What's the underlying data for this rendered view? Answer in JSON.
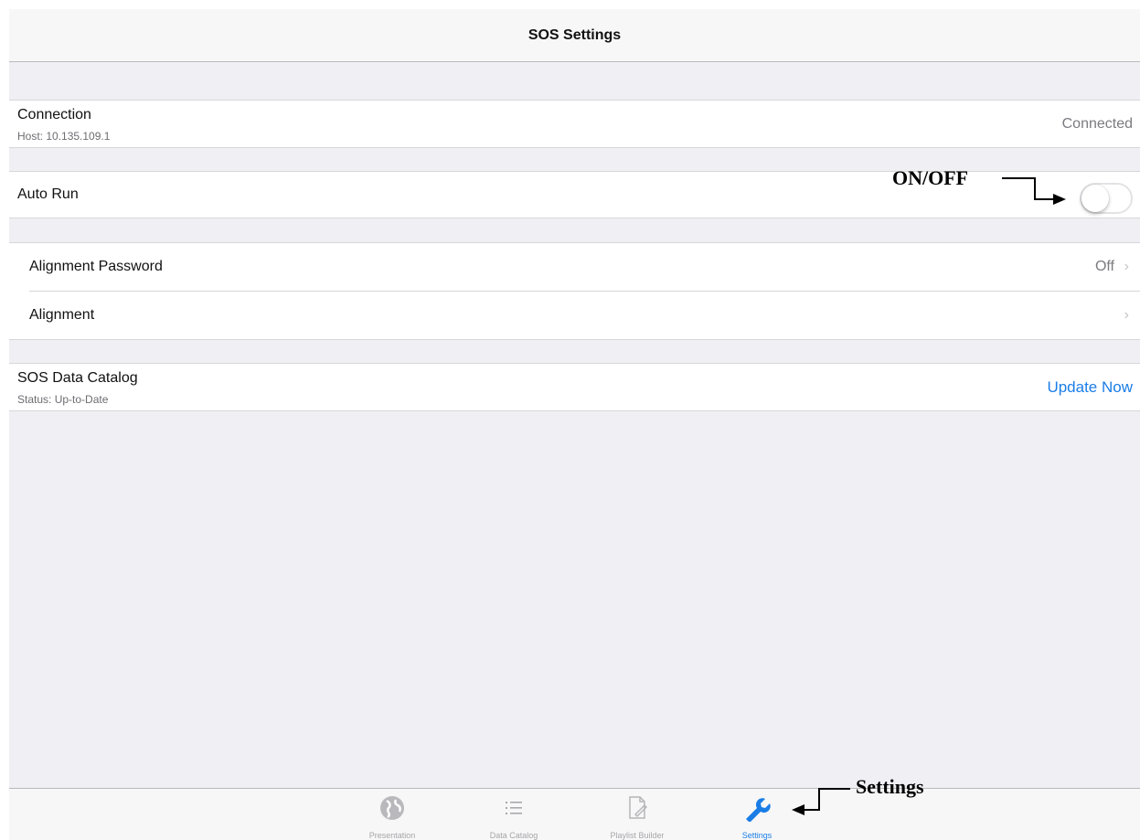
{
  "navbar": {
    "title": "SOS Settings"
  },
  "connection": {
    "title": "Connection",
    "subtitle": "Host: 10.135.109.1",
    "status": "Connected"
  },
  "auto_run": {
    "label": "Auto Run",
    "toggle_on": false
  },
  "alignment_password": {
    "label": "Alignment Password",
    "value": "Off"
  },
  "alignment": {
    "label": "Alignment"
  },
  "data_catalog": {
    "title": "SOS Data Catalog",
    "subtitle": "Status: Up-to-Date",
    "action": "Update Now"
  },
  "annotations": {
    "toggle_label": "ON/OFF",
    "settings_label": "Settings"
  },
  "tabbar": {
    "tabs": [
      {
        "label": "Presentation",
        "icon": "globe-icon",
        "active": false
      },
      {
        "label": "Data Catalog",
        "icon": "list-icon",
        "active": false
      },
      {
        "label": "Playlist Builder",
        "icon": "document-edit-icon",
        "active": false
      },
      {
        "label": "Settings",
        "icon": "wrench-icon",
        "active": true
      }
    ]
  },
  "colors": {
    "accent": "#1a7de6",
    "background": "#efeff4",
    "inactive_tab": "#a6a6aa"
  }
}
